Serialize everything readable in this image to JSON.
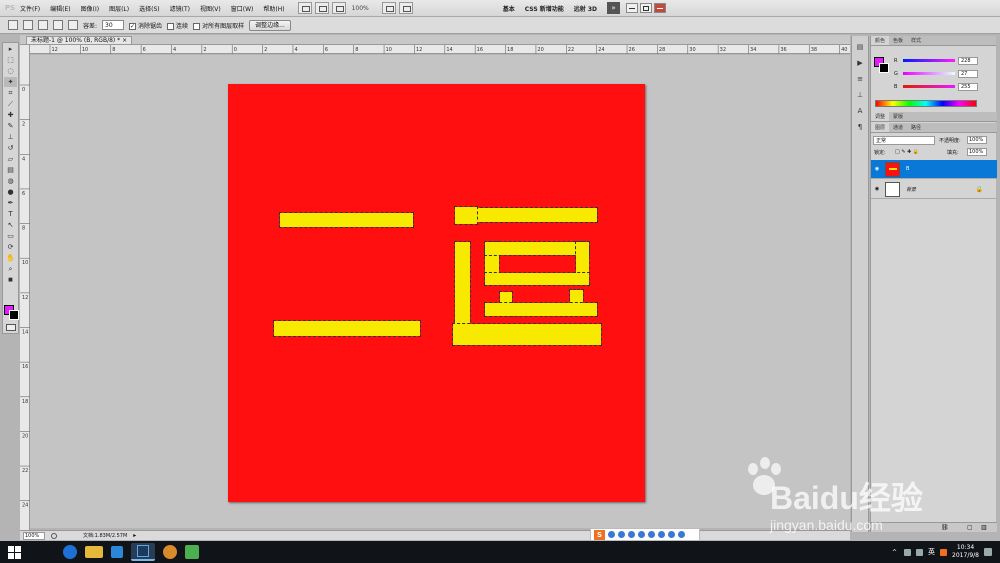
{
  "app": {
    "logo": "PS"
  },
  "menu": [
    "文件(F)",
    "编辑(E)",
    "图像(I)",
    "图层(L)",
    "选择(S)",
    "滤镜(T)",
    "视图(V)",
    "窗口(W)",
    "帮助(H)"
  ],
  "header": {
    "zoom": "100%",
    "workspaces": [
      "基本",
      "CSS 新增功能",
      "远射 3D"
    ],
    "more": "»"
  },
  "options": {
    "tolerance_label": "容差:",
    "tolerance_value": "30",
    "antialias_label": "消除锯齿",
    "contiguous_label": "连续",
    "sample_all_label": "对所有图层取样",
    "refine_edge_label": "调整边缘..."
  },
  "document": {
    "tab_label": "未标题-1 @ 100% (B, RGB/8) *",
    "close": "×"
  },
  "ruler": {
    "top_ticks": [
      "12",
      "10",
      "8",
      "6",
      "4",
      "2",
      "0",
      "2",
      "4",
      "6",
      "8",
      "10",
      "12",
      "14",
      "16",
      "18",
      "20",
      "22",
      "24",
      "26",
      "28",
      "30",
      "32",
      "34",
      "36",
      "38",
      "40"
    ],
    "left_ticks": [
      "0",
      "2",
      "4",
      "6",
      "8",
      "10",
      "12",
      "14",
      "16",
      "18",
      "20",
      "22",
      "24",
      "26"
    ]
  },
  "status": {
    "zoom": "100%",
    "doc_info": "文档:1.83M/2.57M"
  },
  "ime": {
    "logo": "S"
  },
  "panels": {
    "color_tabs": [
      "颜色",
      "色板",
      "样式"
    ],
    "r_label": "R",
    "r_value": "228",
    "g_label": "G",
    "g_value": "27",
    "b_label": "B",
    "b_value": "255",
    "adjust_tabs": [
      "调整",
      "蒙版"
    ],
    "layer_tabs": [
      "图层",
      "通道",
      "路径"
    ],
    "blend_mode": "正常",
    "opacity_label": "不透明度:",
    "opacity_value": "100%",
    "lock_label": "锁定:",
    "fill_label": "填充:",
    "fill_value": "100%",
    "layers": [
      {
        "name": "B"
      },
      {
        "name": "背景"
      }
    ]
  },
  "taskbar": {
    "tray_lang": "英",
    "time": "10:34",
    "date": "2017/9/8"
  },
  "watermark": {
    "brand": "Baidu经验",
    "url": "jingyan.baidu.com"
  },
  "colors": {
    "foreground": "#e41bff",
    "background": "#000000",
    "canvas": "#ff0f0f",
    "glyph": "#f7ea00",
    "layer_selected": "#0a78d7"
  }
}
